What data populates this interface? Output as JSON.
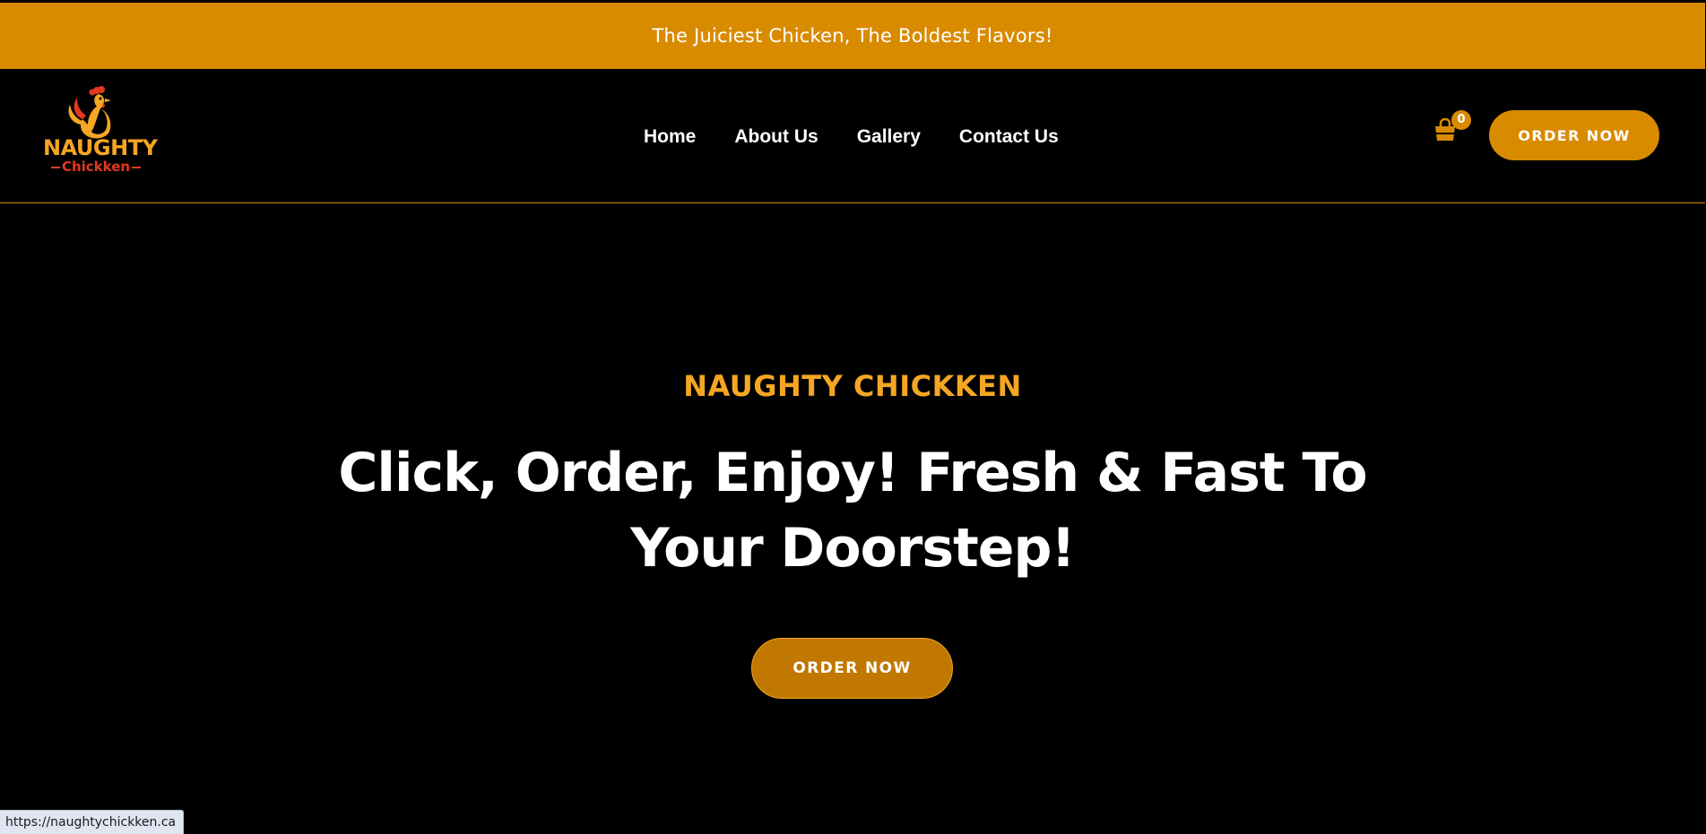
{
  "announcement": {
    "text": "The Juiciest Chicken, The Boldest Flavors!"
  },
  "brand": {
    "logo_word1": "NAUGHTY",
    "logo_word2": "Chickken",
    "accent_color": "#d98b00",
    "accent_text_color": "#f5a623",
    "logo_red": "#e03a1e"
  },
  "nav": {
    "items": [
      {
        "label": "Home"
      },
      {
        "label": "About Us"
      },
      {
        "label": "Gallery"
      },
      {
        "label": "Contact Us"
      }
    ]
  },
  "cart": {
    "icon": "shopping-bag-icon",
    "count": "0"
  },
  "header_cta": {
    "label": "ORDER NOW"
  },
  "hero": {
    "eyebrow": "NAUGHTY CHICKKEN",
    "title": "Click, Order, Enjoy! Fresh & Fast To Your Doorstep!",
    "cta_label": "ORDER NOW"
  },
  "status_bar": {
    "url": "https://naughtychickken.ca"
  }
}
